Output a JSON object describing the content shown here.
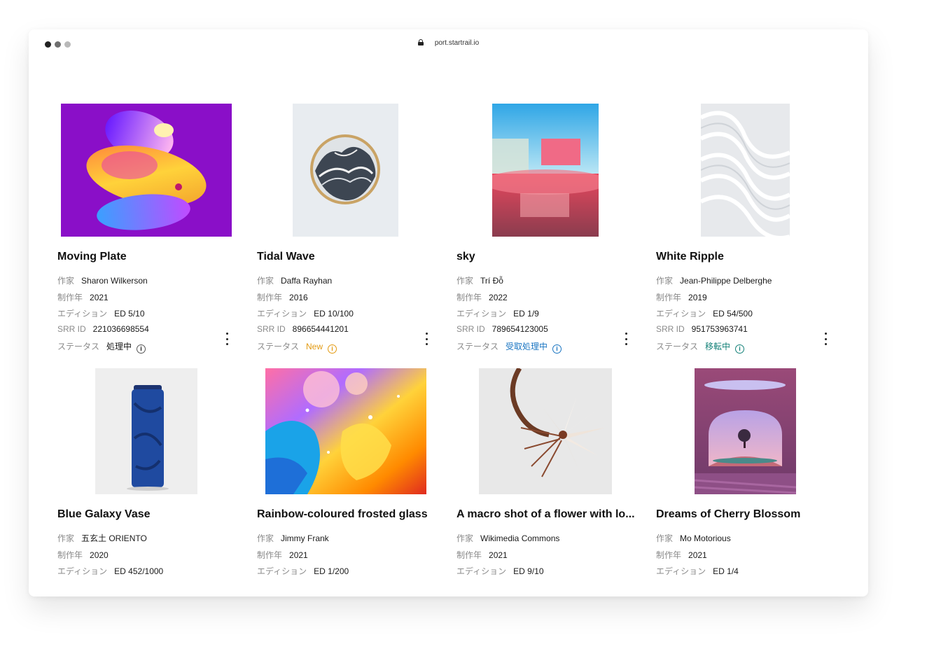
{
  "browser": {
    "url": "port.startrail.io"
  },
  "labels": {
    "artist": "作家",
    "year": "制作年",
    "edition": "エディション",
    "srr": "SRR ID",
    "status": "ステータス"
  },
  "row1": [
    {
      "title": "Moving Plate",
      "artist": "Sharon Wilkerson",
      "year": "2021",
      "edition": "ED 5/10",
      "srr": "221036698554",
      "status": "処理中",
      "status_color": "#1a1a1a"
    },
    {
      "title": "Tidal Wave",
      "artist": "Daffa Rayhan",
      "year": "2016",
      "edition": "ED 10/100",
      "srr": "896654441201",
      "status": "New",
      "status_color": "#e39a11"
    },
    {
      "title": "sky",
      "artist": "Trí Đỗ",
      "year": "2022",
      "edition": "ED 1/9",
      "srr": "789654123005",
      "status": "受取処理中",
      "status_color": "#1a75c2"
    },
    {
      "title": "White Ripple",
      "artist": "Jean-Philippe Delberghe",
      "year": "2019",
      "edition": "ED 54/500",
      "srr": "951753963741",
      "status": "移転中",
      "status_color": "#138178"
    }
  ],
  "row2": [
    {
      "title": "Blue Galaxy Vase",
      "artist": "五玄土 ORIENTO",
      "year": "2020",
      "edition": "ED 452/1000"
    },
    {
      "title": "Rainbow-coloured frosted glass",
      "artist": "Jimmy Frank",
      "year": "2021",
      "edition": "ED 1/200"
    },
    {
      "title": "A macro shot of a flower with lo...",
      "artist": "Wikimedia Commons",
      "year": "2021",
      "edition": "ED 9/10"
    },
    {
      "title": "Dreams of Cherry Blossom",
      "artist": "Mo Motorious",
      "year": "2021",
      "edition": "ED 1/4"
    }
  ]
}
